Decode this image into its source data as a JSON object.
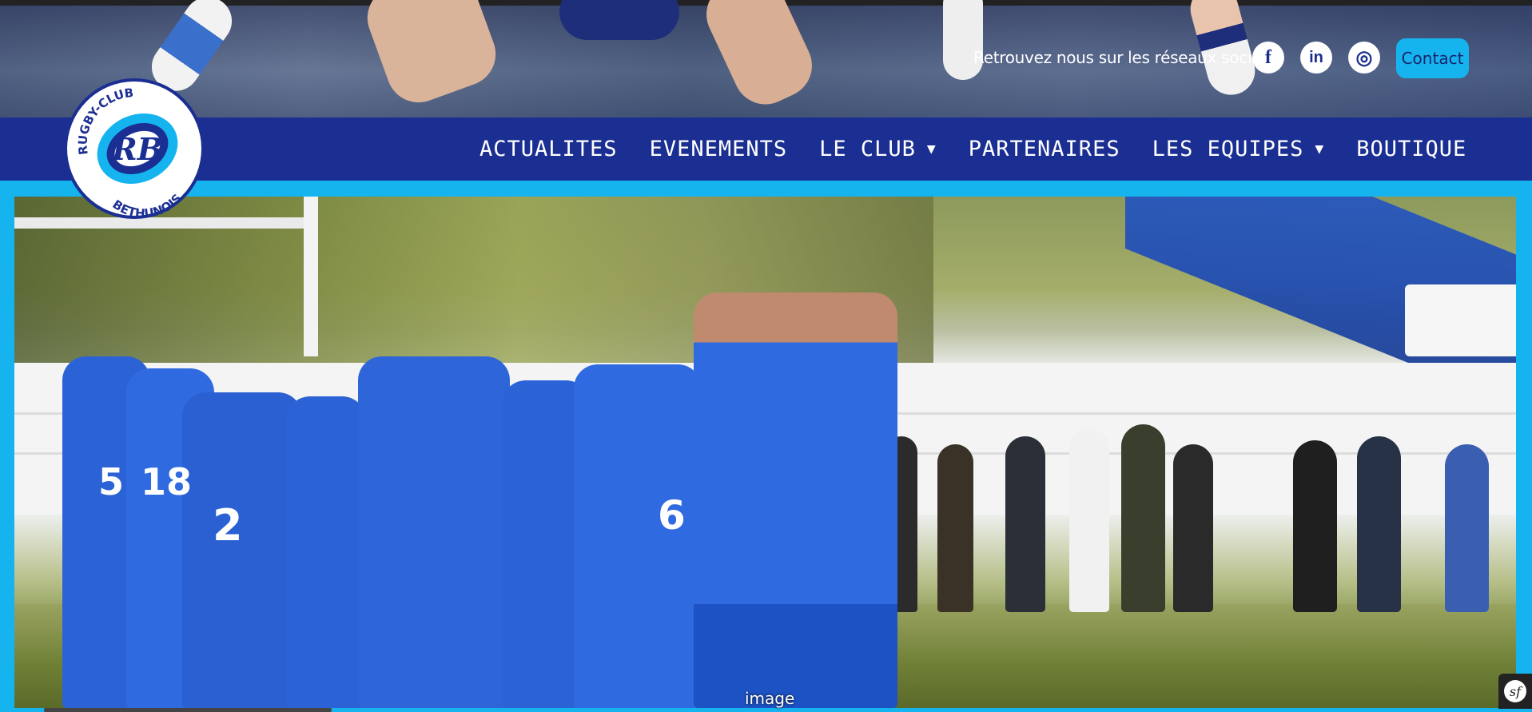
{
  "header": {
    "social_text": "Retrouvez nous sur les réseaux sociaux",
    "social_links": [
      {
        "name": "facebook",
        "glyph": "f"
      },
      {
        "name": "linkedin",
        "glyph": "in"
      },
      {
        "name": "instagram",
        "glyph": "◎"
      }
    ],
    "contact_label": "Contact"
  },
  "logo": {
    "text_top": "RUGBY-CLUB",
    "text_bottom": "BETHUNOIS",
    "monogram": "RB"
  },
  "nav": {
    "items": [
      {
        "label": "ACTUALITES",
        "dropdown": false
      },
      {
        "label": "EVENEMENTS",
        "dropdown": false
      },
      {
        "label": "LE CLUB",
        "dropdown": true
      },
      {
        "label": "PARTENAIRES",
        "dropdown": false
      },
      {
        "label": "LES EQUIPES",
        "dropdown": true
      },
      {
        "label": "BOUTIQUE",
        "dropdown": false
      }
    ],
    "caret_glyph": "▼"
  },
  "hero": {
    "caption": "image",
    "jersey_numbers": [
      "5",
      "18",
      "2",
      "6"
    ]
  },
  "badge": {
    "glyph": "sf"
  },
  "colors": {
    "nav_bg": "#1b2f93",
    "accent": "#16b4ef",
    "jersey_blue": "#2b63d6"
  }
}
